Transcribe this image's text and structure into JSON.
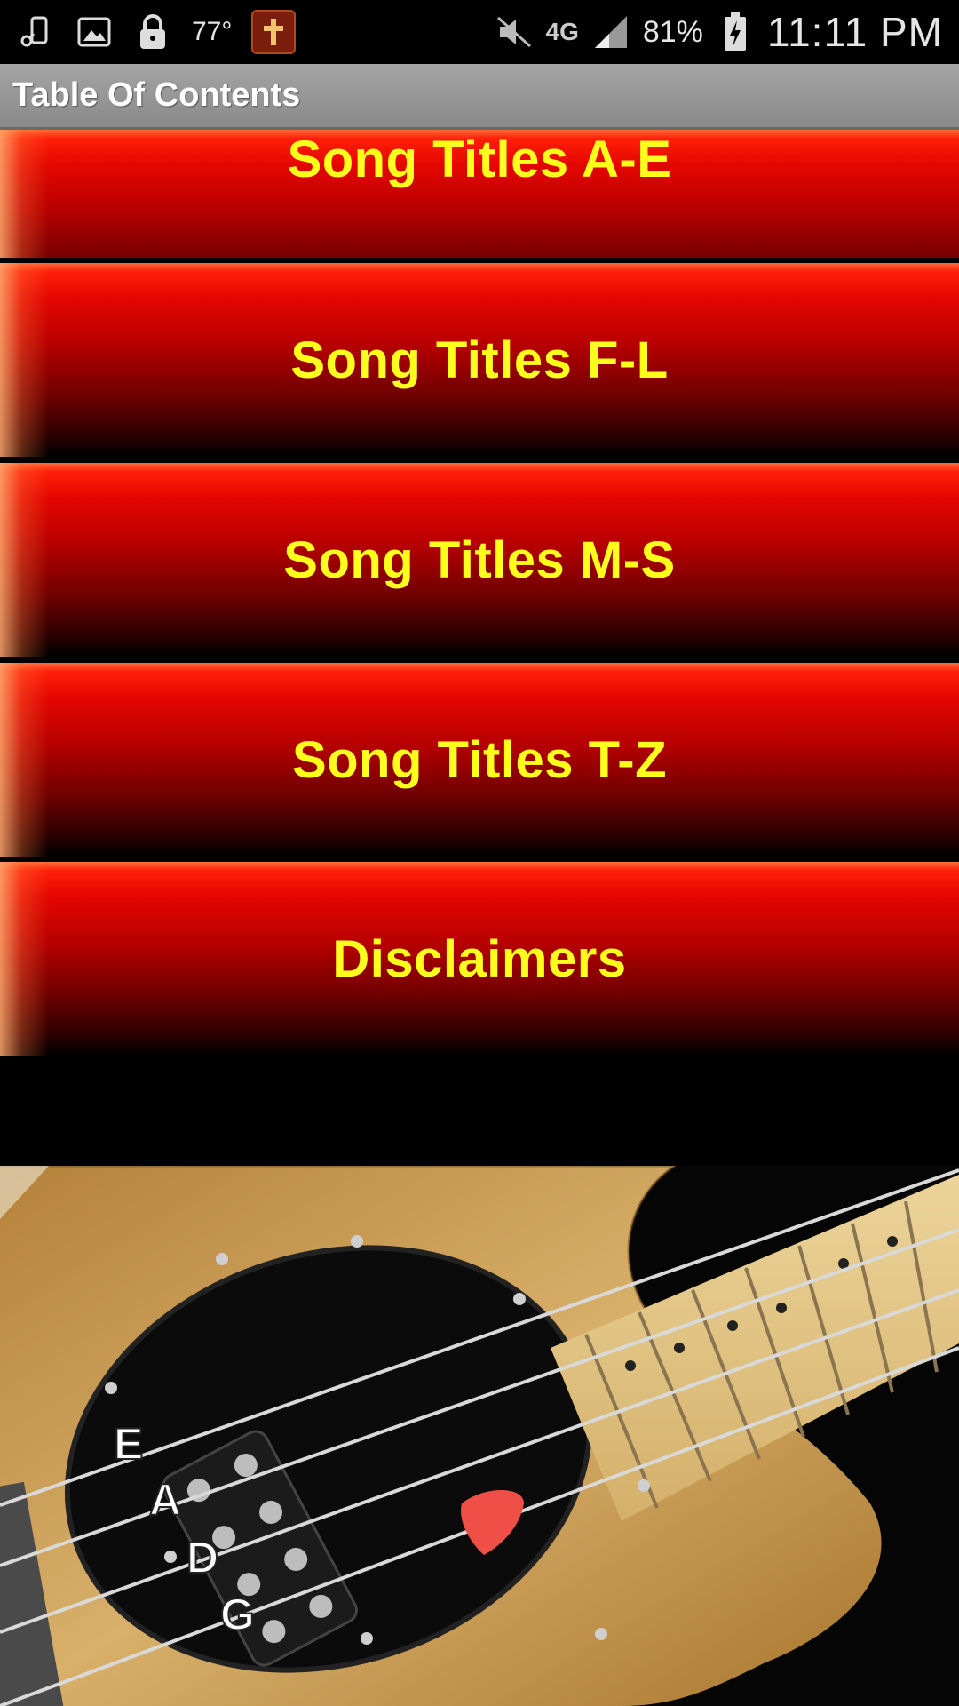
{
  "status_bar": {
    "temperature": "77°",
    "network": "4G",
    "battery": "81%",
    "time": "11:11 PM"
  },
  "title_bar": {
    "title": "Table Of Contents"
  },
  "menu": [
    {
      "label": "Song Titles A-E"
    },
    {
      "label": "Song Titles F-L"
    },
    {
      "label": "Song Titles M-S"
    },
    {
      "label": "Song Titles T-Z"
    },
    {
      "label": "Disclaimers"
    }
  ],
  "guitar_image": {
    "string_labels": [
      "E",
      "A",
      "D",
      "G"
    ]
  },
  "colors": {
    "button_red": "#e40600",
    "button_text": "#ffff1e",
    "title_bar": "#9a9a9a"
  }
}
